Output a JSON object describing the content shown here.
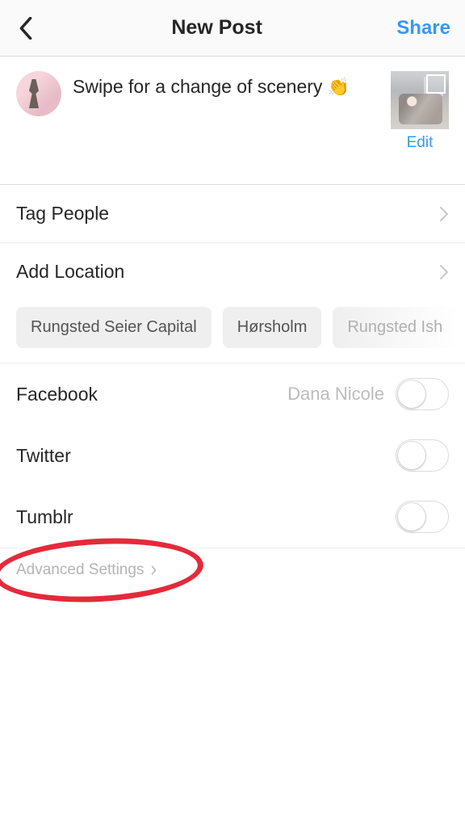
{
  "header": {
    "title": "New Post",
    "share_label": "Share"
  },
  "caption": {
    "text": "Swipe for a change of scenery",
    "emoji": "👏",
    "edit_label": "Edit"
  },
  "rows": {
    "tag_people": "Tag People",
    "add_location": "Add Location"
  },
  "location_suggestions": [
    "Rungsted Seier Capital",
    "Hørsholm",
    "Rungsted Ish"
  ],
  "share_accounts": {
    "facebook": {
      "label": "Facebook",
      "account": "Dana Nicole"
    },
    "twitter": {
      "label": "Twitter"
    },
    "tumblr": {
      "label": "Tumblr"
    }
  },
  "advanced": {
    "label": "Advanced Settings"
  }
}
